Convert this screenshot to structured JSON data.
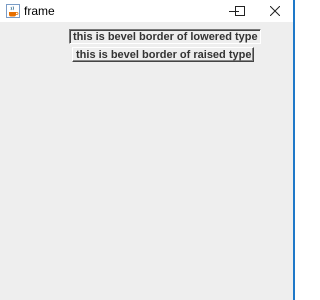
{
  "window": {
    "title": "frame",
    "accent_border_color": "#1e78c8",
    "icons": {
      "app": "java-coffee-cup-icon",
      "minimize": "minimize-icon",
      "maximize": "maximize-icon",
      "close": "close-icon"
    }
  },
  "content": {
    "background": "#eeeeee",
    "labels": {
      "lowered": "this is bevel border of lowered type",
      "raised": "this is bevel border of raised type"
    }
  }
}
